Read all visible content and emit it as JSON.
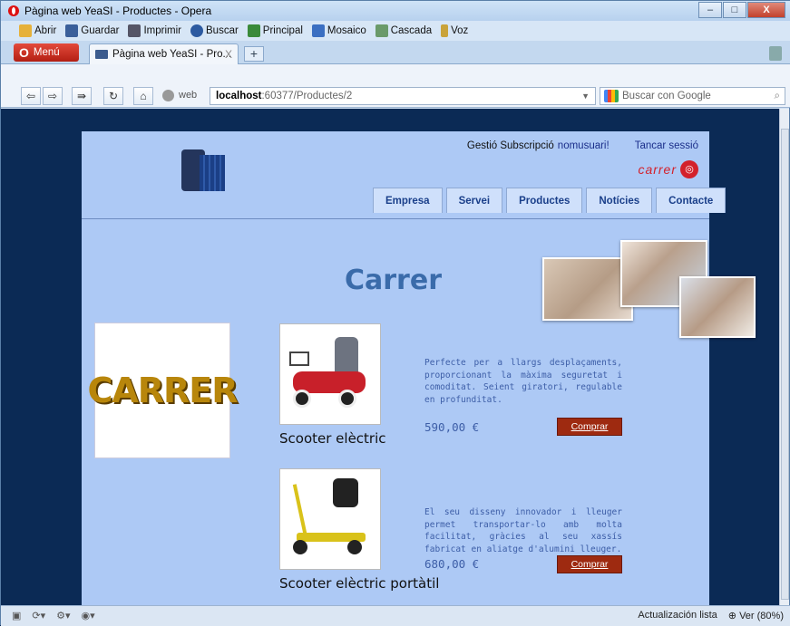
{
  "window": {
    "title": "Pàgina web YeaSI - Productes - Opera",
    "controls": [
      "–",
      "□",
      "X"
    ]
  },
  "toolbar": {
    "items": [
      "Abrir",
      "Guardar",
      "Imprimir",
      "Buscar",
      "Principal",
      "Mosaico",
      "Cascada",
      "Voz"
    ]
  },
  "tabs": {
    "menu_label": "Menú",
    "active_tab": "Pàgina web YeaSI - Pro...",
    "close": "X",
    "new_tab": "+"
  },
  "address": {
    "web_label": "web",
    "host": "localhost",
    "path": ":60377/Productes/2",
    "search_placeholder": "Buscar con Google"
  },
  "site": {
    "header": {
      "gestio": "Gestió Subscripció",
      "user": "nomusuari!",
      "logout": "Tancar sessió",
      "brand_logo_text": "carrer"
    },
    "nav": [
      "Empresa",
      "Servei",
      "Productes",
      "Notícies",
      "Contacte"
    ],
    "heading": "Carrer",
    "brand_box_text": "CARRER",
    "products": [
      {
        "title": "Scooter elèctric",
        "description": "Perfecte per a llargs desplaçaments, proporcionant la màxima seguretat i comoditat. Seient giratori, regulable en profunditat.",
        "price": "590,00 €",
        "button": "Comprar"
      },
      {
        "title": "Scooter elèctric portàtil",
        "description": "El seu disseny innovador i lleuger permet transportar-lo amb molta facilitat, gràcies al seu xassís fabricat en aliatge d'alumini lleuger.",
        "price": "680,00 €",
        "button": "Comprar"
      }
    ]
  },
  "statusbar": {
    "status_text": "Actualización lista",
    "zoom": "Ver (80%)"
  }
}
